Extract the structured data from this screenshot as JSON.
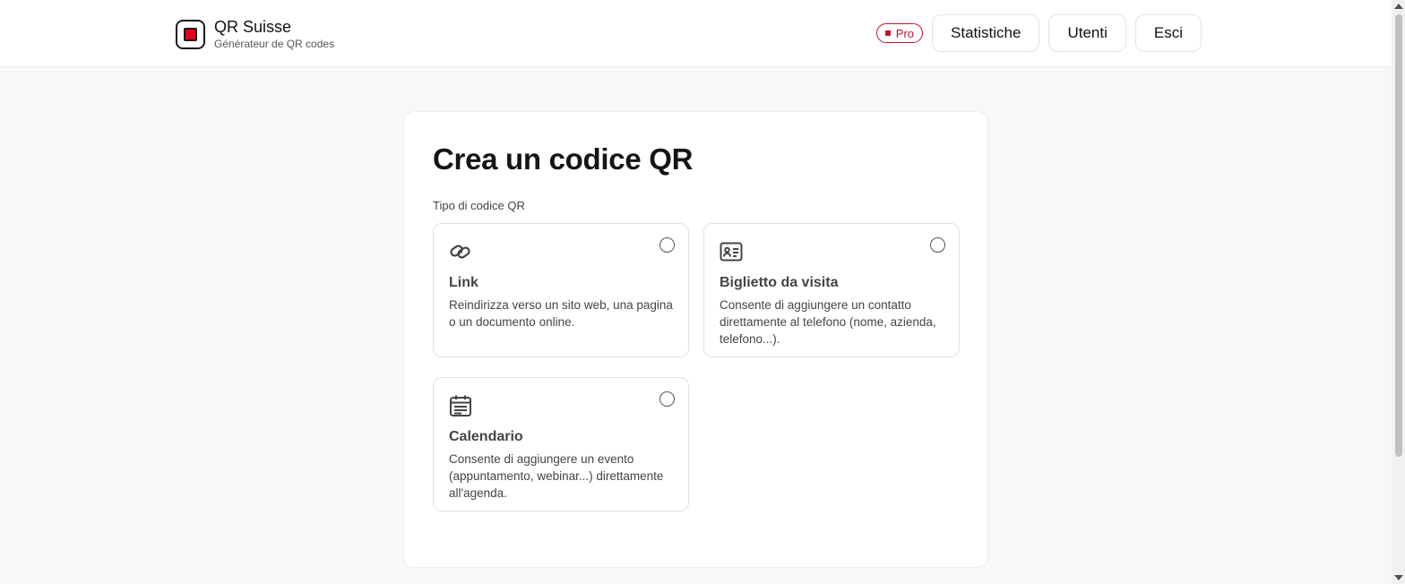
{
  "header": {
    "brand_title": "QR Suisse",
    "brand_subtitle": "Générateur de QR codes",
    "pro_badge": "Pro",
    "nav": {
      "stats": "Statistiche",
      "users": "Utenti",
      "logout": "Esci"
    }
  },
  "main": {
    "title": "Crea un codice QR",
    "type_label": "Tipo di codice QR",
    "options": [
      {
        "icon": "link-icon",
        "title": "Link",
        "description": "Reindirizza verso un sito web, una pagina o un documento online.",
        "selected": false
      },
      {
        "icon": "contact-card-icon",
        "title": "Biglietto da visita",
        "description": "Consente di aggiungere un contatto direttamente al telefono (nome, azienda, telefono...).",
        "selected": false
      },
      {
        "icon": "calendar-icon",
        "title": "Calendario",
        "description": "Consente di aggiungere un evento (appuntamento, webinar...) direttamente all'agenda.",
        "selected": false
      }
    ]
  },
  "colors": {
    "accent": "#c8102e",
    "brand_red": "#e3001b",
    "background": "#f8f8f8"
  }
}
